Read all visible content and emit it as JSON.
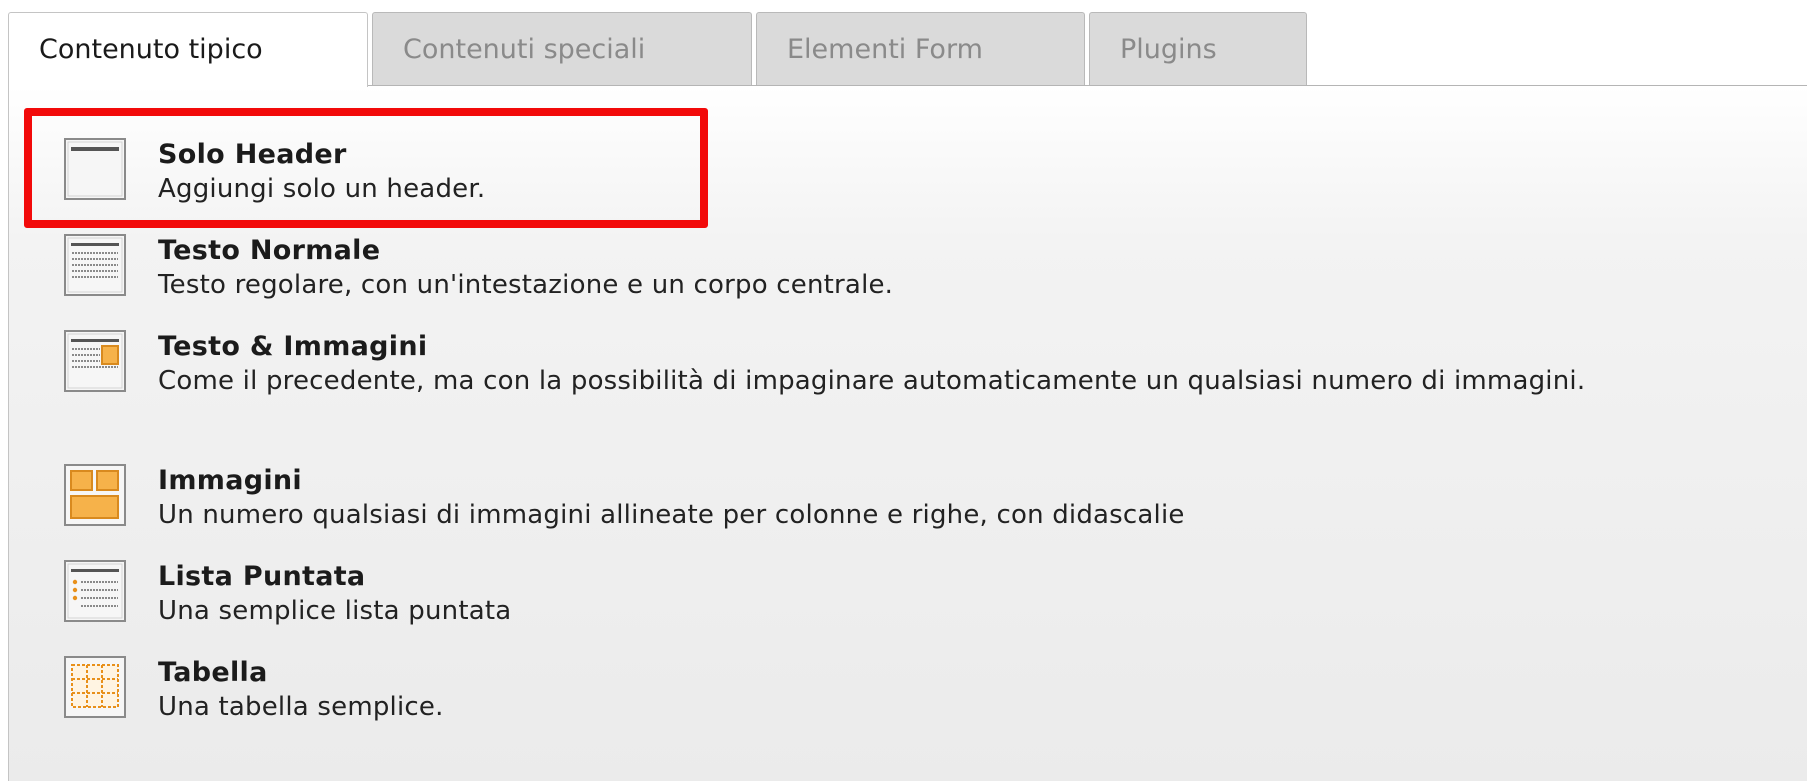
{
  "tabs": [
    {
      "label": "Contenuto tipico",
      "active": true
    },
    {
      "label": "Contenuti speciali",
      "active": false
    },
    {
      "label": "Elementi Form",
      "active": false
    },
    {
      "label": "Plugins",
      "active": false
    }
  ],
  "items": [
    {
      "title": "Solo Header",
      "description": "Aggiungi solo un header.",
      "icon": "header-only-icon",
      "selected": true
    },
    {
      "title": "Testo Normale",
      "description": "Testo regolare, con un'intestazione e un corpo centrale.",
      "icon": "text-icon",
      "selected": false
    },
    {
      "title": "Testo & Immagini",
      "description": "Come il precedente, ma con la possibilità di impaginare automaticamente un qualsiasi numero di immagini.",
      "icon": "text-images-icon",
      "selected": false
    },
    {
      "title": "Immagini",
      "description": "Un numero qualsiasi di immagini allineate per colonne e righe, con didascalie",
      "icon": "images-icon",
      "selected": false
    },
    {
      "title": "Lista Puntata",
      "description": "Una semplice lista puntata",
      "icon": "bullet-list-icon",
      "selected": false
    },
    {
      "title": "Tabella",
      "description": "Una tabella semplice.",
      "icon": "table-icon",
      "selected": false
    }
  ],
  "colors": {
    "highlight": "#f20a0a",
    "accent": "#f0a030",
    "tab_inactive": "#dadada"
  }
}
